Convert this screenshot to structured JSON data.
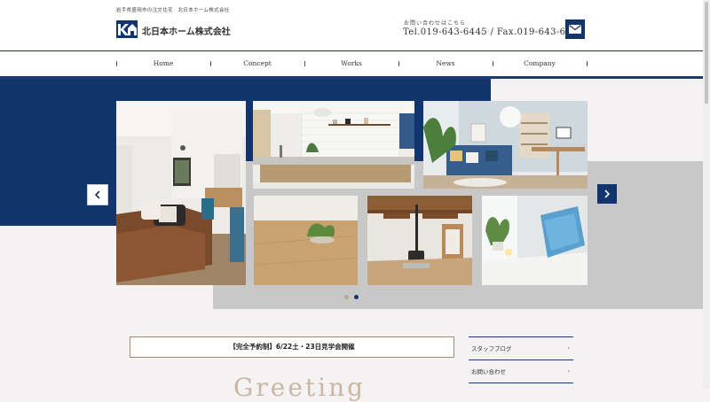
{
  "header": {
    "tagline": "岩手県盛岡市の注文住宅　北日本ホーム株式会社",
    "logo_text": "北日本ホーム株式会社",
    "contact_caption": "お問い合わせはこちら",
    "contact_tel": "Tel.019-643-6445 / Fax.019-643-6448",
    "mail_icon": "mail-icon"
  },
  "nav": {
    "items": [
      {
        "label": "Home"
      },
      {
        "label": "Concept"
      },
      {
        "label": "Works"
      },
      {
        "label": "News"
      },
      {
        "label": "Company"
      }
    ]
  },
  "slider": {
    "prev_icon": "chevron-left-icon",
    "next_icon": "chevron-right-icon",
    "photos": [
      "living-room-sofa-photo",
      "kitchen-counter-photo",
      "blue-sofa-living-photo",
      "wood-floor-plant-photo",
      "wood-stove-room-photo",
      "window-cushion-plant-photo"
    ],
    "active_slide": 2,
    "slide_count": 2
  },
  "event_banner": {
    "text": "【完全予約制】6/22土・23日見学会開催"
  },
  "side_links": [
    {
      "label": "スタッフブログ"
    },
    {
      "label": "お問い合わせ"
    }
  ],
  "greeting": {
    "title": "Greeting"
  },
  "colors": {
    "navy": "#12356e",
    "gray_block": "#c8c8c8",
    "page_bg": "#f4f2f2",
    "accent_tan": "#a68a6a"
  }
}
